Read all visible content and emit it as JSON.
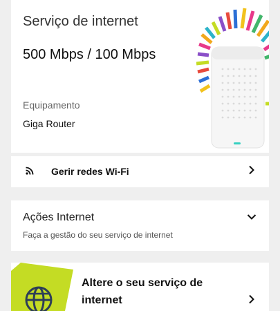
{
  "service": {
    "title": "Serviço de internet",
    "speed": "500 Mbps / 100 Mbps",
    "equipment_label": "Equipamento",
    "equipment_value": "Giga Router"
  },
  "wifi": {
    "label": "Gerir redes Wi-Fi"
  },
  "actions": {
    "title": "Ações Internet",
    "subtitle": "Faça a gestão do seu serviço de internet"
  },
  "change": {
    "title": "Altere o seu serviço de internet"
  },
  "colors": {
    "accent_green": "#c4dc24",
    "background": "#efefef",
    "card": "#ffffff"
  },
  "icons": [
    "router-image",
    "wifi-icon",
    "chevron-right-icon",
    "chevron-down-icon",
    "globe-icon"
  ]
}
